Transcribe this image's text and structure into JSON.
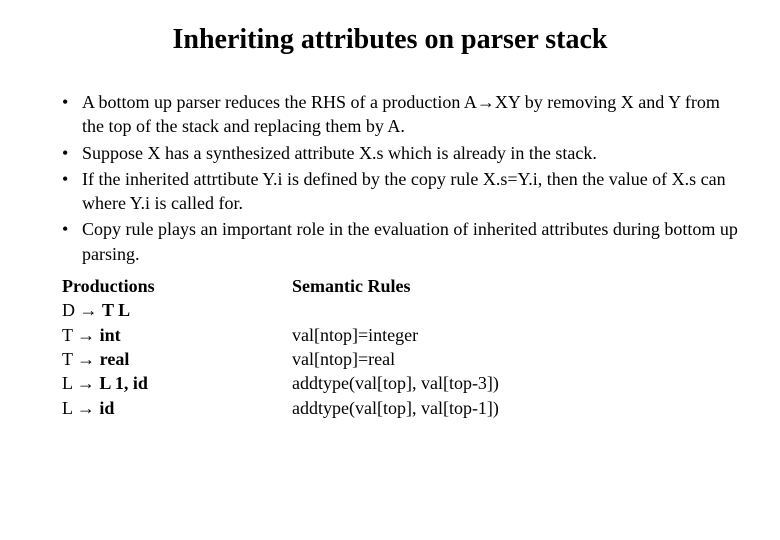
{
  "title": "Inheriting attributes on parser stack",
  "bullets": [
    "A bottom up parser reduces the RHS of a production A→XY by removing X and Y from the top of the stack and replacing them by A.",
    "Suppose X has a synthesized attribute X.s which is already in the stack.",
    "If the inherited attrtibute Y.i is defined by the copy rule X.s=Y.i, then the value of X.s can where Y.i is called for.",
    "Copy rule plays an important role in the evaluation of inherited attributes during bottom up parsing."
  ],
  "columns": {
    "left_header": "Productions",
    "right_header": "Semantic Rules",
    "rows": [
      {
        "prod_prefix": "D → ",
        "prod_bold": "T L",
        "rule": ""
      },
      {
        "prod_prefix": "T → ",
        "prod_bold": "int",
        "rule": "val[ntop]=integer"
      },
      {
        "prod_prefix": "T → ",
        "prod_bold": "real",
        "rule": "val[ntop]=real"
      },
      {
        "prod_prefix": "L → ",
        "prod_bold": "L 1, id",
        "rule": "addtype(val[top], val[top-3])"
      },
      {
        "prod_prefix": "L → ",
        "prod_bold": "id",
        "rule": "addtype(val[top], val[top-1])"
      }
    ]
  }
}
